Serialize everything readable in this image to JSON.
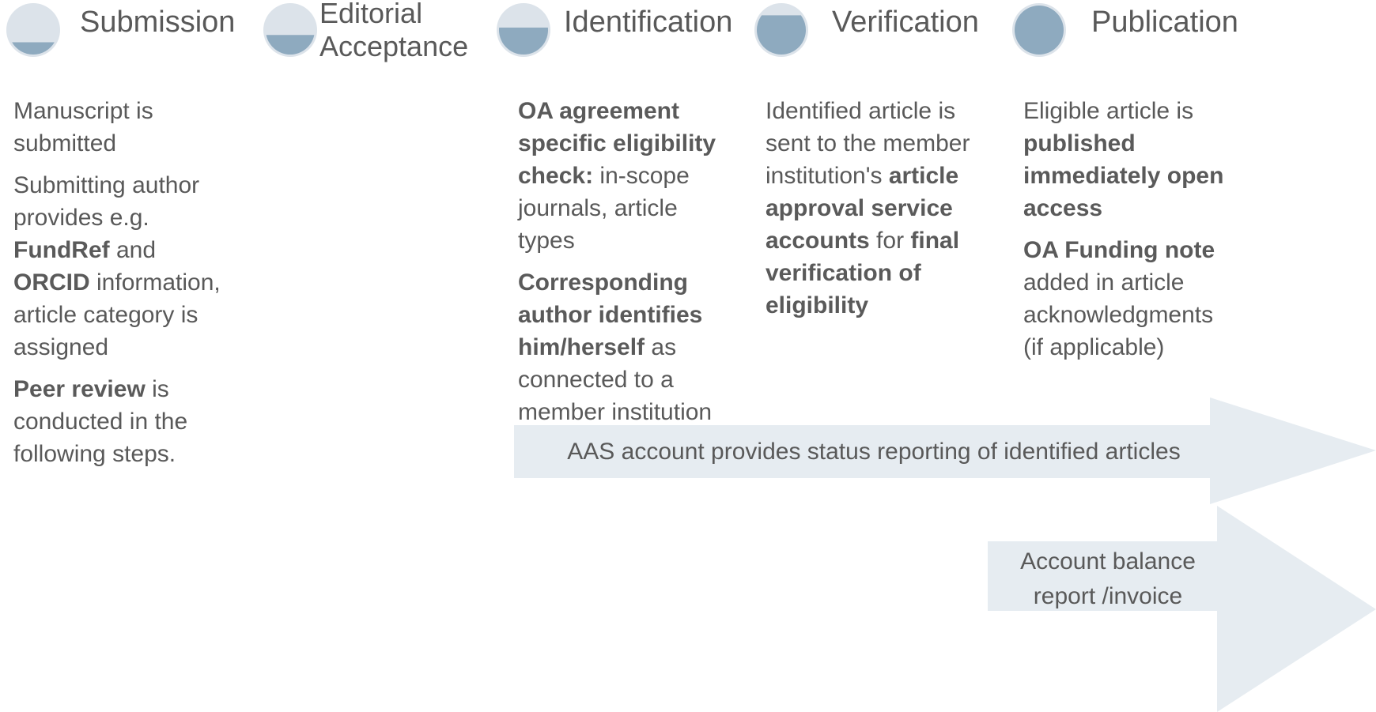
{
  "colors": {
    "circle_bg": "#dce3ea",
    "circle_fill": "#8eaabf",
    "arrow_fill": "#e6ecf1",
    "text": "#595959"
  },
  "stages": [
    {
      "title": "Submission",
      "progress": 0.25
    },
    {
      "title_lines": [
        "Editorial",
        "Acceptance"
      ],
      "progress": 0.4
    },
    {
      "title": "Identification",
      "progress": 0.55
    },
    {
      "title": "Verification",
      "progress": 0.8
    },
    {
      "title": "Publication",
      "progress": 1.0
    }
  ],
  "columns": {
    "submission": {
      "p1": "Manuscript is submitted",
      "p2_a": "Submitting author provides e.g. ",
      "p2_b1": "FundRef",
      "p2_c": " and ",
      "p2_b2": "ORCID",
      "p2_d": " information, article category is assigned",
      "p3_b": "Peer review",
      "p3_a": " is conducted in the following steps."
    },
    "identification": {
      "p1_b": "OA agreement specific eligibility check:",
      "p1_a": " in-scope journals, article types",
      "p2_b": "Corresponding author identifies him/herself",
      "p2_a": " as connected to a member institution"
    },
    "verification": {
      "a": "Identified article is sent to the member institution's ",
      "b1": "article approval service accounts",
      "c": " for ",
      "b2": "final verification of eligibility"
    },
    "publication": {
      "p1_a": "Eligible article is ",
      "p1_b": "published immediately open access",
      "p2_b": "OA Funding note",
      "p2_a": " added in article acknowledgments (if applicable)"
    }
  },
  "arrows": {
    "status_report": "AAS account provides status reporting of identified articles",
    "balance_line1": "Account balance",
    "balance_line2": "report /invoice"
  }
}
